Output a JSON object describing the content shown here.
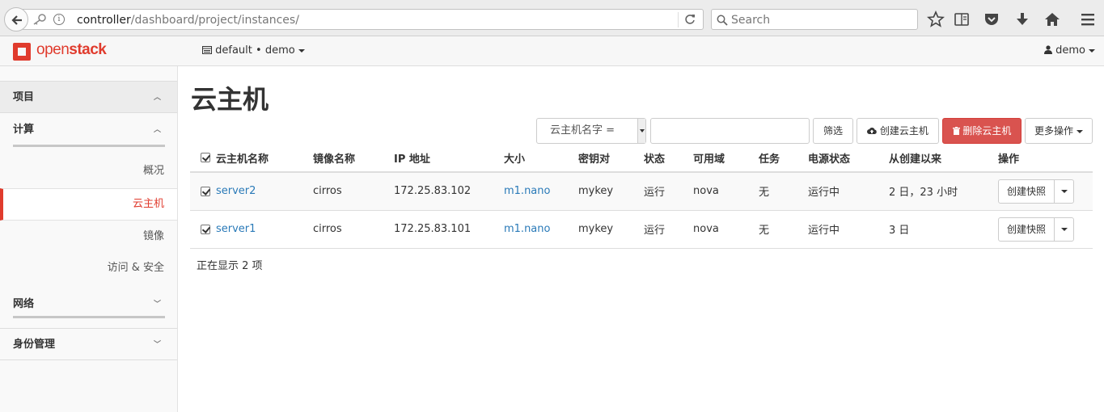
{
  "browser": {
    "url_host": "controller",
    "url_path": "/dashboard/project/instances/",
    "search_placeholder": "Search"
  },
  "header": {
    "logo_open": "open",
    "logo_stack": "stack",
    "project": "default • demo",
    "user": "demo"
  },
  "sidebar": {
    "sections": [
      {
        "label": "项目"
      },
      {
        "label": "计算"
      },
      {
        "label": "网络"
      },
      {
        "label": "身份管理"
      }
    ],
    "items": [
      {
        "label": "概况"
      },
      {
        "label": "云主机"
      },
      {
        "label": "镜像"
      },
      {
        "label": "访问 & 安全"
      }
    ]
  },
  "main": {
    "title": "云主机",
    "filter_select": "云主机名字 =",
    "filter_value": "",
    "buttons": {
      "filter": "筛选",
      "create": "创建云主机",
      "delete": "删除云主机",
      "more": "更多操作"
    },
    "columns": [
      "云主机名称",
      "镜像名称",
      "IP 地址",
      "大小",
      "密钥对",
      "状态",
      "可用域",
      "任务",
      "电源状态",
      "从创建以来",
      "操作"
    ],
    "rows": [
      {
        "name": "server2",
        "image": "cirros",
        "ip": "172.25.83.102",
        "size": "m1.nano",
        "keypair": "mykey",
        "status": "运行",
        "az": "nova",
        "task": "无",
        "power": "运行中",
        "age": "2 日，23 小时",
        "action": "创建快照"
      },
      {
        "name": "server1",
        "image": "cirros",
        "ip": "172.25.83.101",
        "size": "m1.nano",
        "keypair": "mykey",
        "status": "运行",
        "az": "nova",
        "task": "无",
        "power": "运行中",
        "age": "3 日",
        "action": "创建快照"
      }
    ],
    "count_text": "正在显示 2 项"
  },
  "colors": {
    "brand": "#e03b2d",
    "danger": "#d9534f",
    "link": "#2a7ab8"
  }
}
